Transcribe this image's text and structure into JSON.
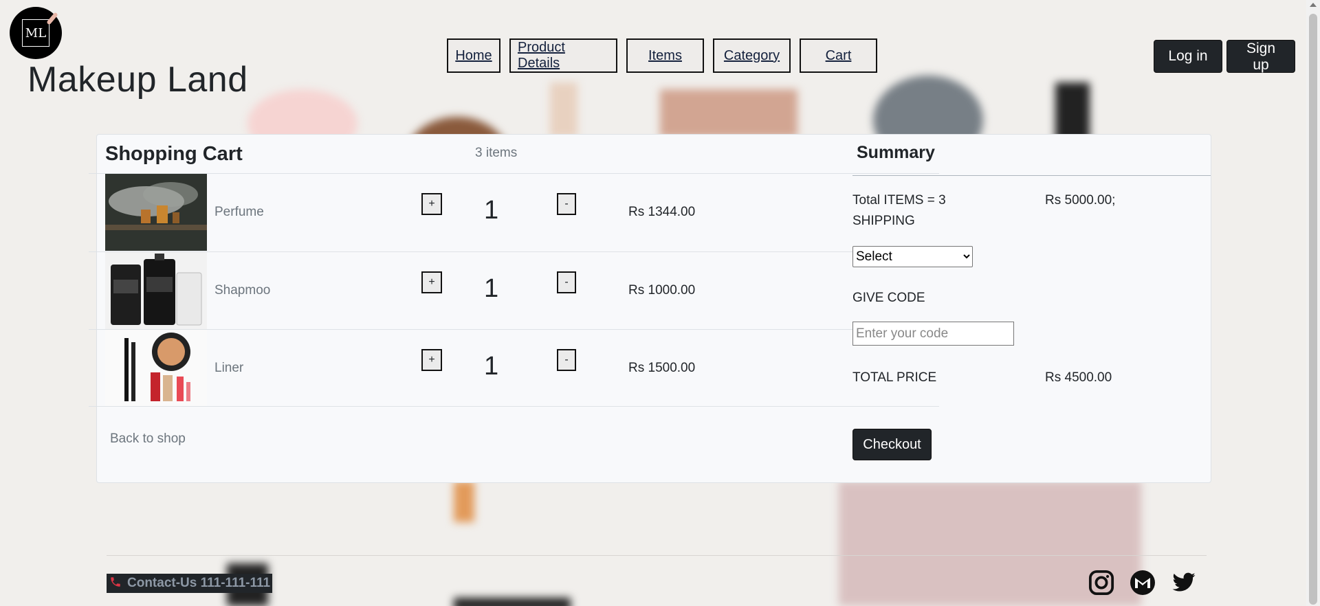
{
  "brand": {
    "logo_text": "ML",
    "name": "Makeup Land"
  },
  "nav": [
    {
      "label": "Home"
    },
    {
      "label": "Product Details"
    },
    {
      "label": "Items"
    },
    {
      "label": "Category"
    },
    {
      "label": "Cart"
    }
  ],
  "auth": {
    "login": "Log in",
    "signup": "Sign up"
  },
  "cart": {
    "title": "Shopping Cart",
    "count": "3 items",
    "plus_label": "+",
    "minus_label": "-",
    "items": [
      {
        "name": "Perfume",
        "qty": "1",
        "price": "Rs 1344.00"
      },
      {
        "name": "Shapmoo",
        "qty": "1",
        "price": "Rs 1000.00"
      },
      {
        "name": "Liner",
        "qty": "1",
        "price": "Rs 1500.00"
      }
    ],
    "back": "Back to shop"
  },
  "summary": {
    "title": "Summary",
    "total_items_label": "Total ITEMS = 3",
    "total_items_value": "Rs 5000.00;",
    "shipping_label": "SHIPPING",
    "shipping_select": "Select",
    "code_label": "GIVE CODE",
    "code_placeholder": "Enter your code",
    "total_price_label": "TOTAL PRICE",
    "total_price_value": "Rs 4500.00",
    "checkout": "Checkout"
  },
  "footer": {
    "contact": "Contact-Us 111-111-111",
    "icons": [
      "instagram-icon",
      "gmail-icon",
      "twitter-icon"
    ]
  },
  "colors": {
    "dark": "#212529",
    "page_bg": "#f1efec",
    "card_bg": "#f8f9fb",
    "phone_icon": "#dc3545"
  }
}
